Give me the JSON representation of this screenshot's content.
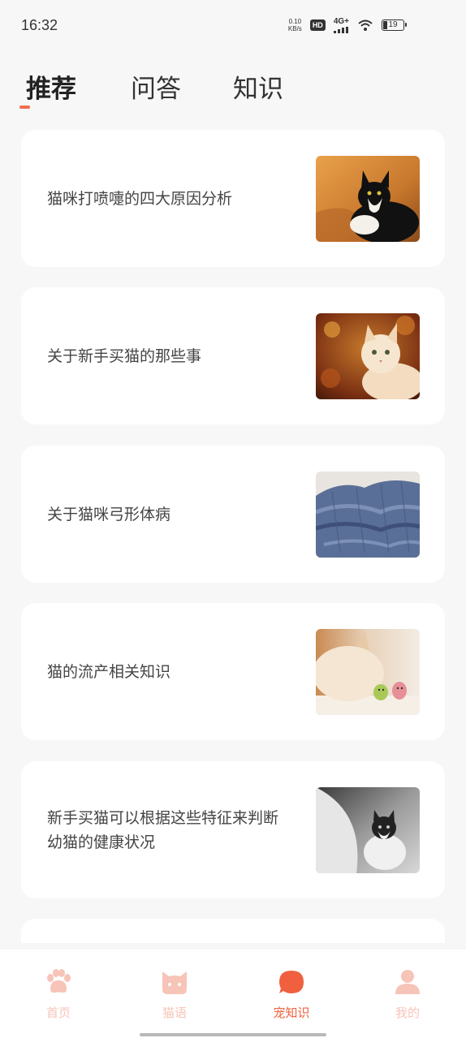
{
  "status_bar": {
    "time": "16:32",
    "net_speed_value": "0.10",
    "net_speed_unit": "KB/s",
    "hd_badge": "HD",
    "signal_label": "4G+",
    "battery_level": "19",
    "icons": [
      "hd-icon",
      "signal-icon",
      "wifi-icon",
      "battery-icon"
    ]
  },
  "tabs": [
    {
      "label": "推荐",
      "active": true
    },
    {
      "label": "问答",
      "active": false
    },
    {
      "label": "知识",
      "active": false
    }
  ],
  "articles": [
    {
      "title": "猫咪打喷嚏的四大原因分析",
      "thumbnail": "black-white-cat-photo"
    },
    {
      "title": "关于新手买猫的那些事",
      "thumbnail": "fluffy-cat-autumn-leaves-photo"
    },
    {
      "title": "关于猫咪弓形体病",
      "thumbnail": "blue-knit-sweater-photo"
    },
    {
      "title": "猫的流产相关知识",
      "thumbnail": "cat-with-toys-photo"
    },
    {
      "title": "新手买猫可以根据这些特征来判断幼猫的健康状况",
      "thumbnail": "kitten-grayscale-photo"
    }
  ],
  "bottom_nav": [
    {
      "label": "首页",
      "icon": "paw-icon",
      "active": false
    },
    {
      "label": "猫语",
      "icon": "cat-face-icon",
      "active": false
    },
    {
      "label": "宠知识",
      "icon": "chat-bubble-icon",
      "active": true
    },
    {
      "label": "我的",
      "icon": "person-icon",
      "active": false
    }
  ],
  "colors": {
    "accent": "#f26d4f",
    "nav_inactive": "#f7c4b8",
    "background": "#f7f7f7"
  }
}
